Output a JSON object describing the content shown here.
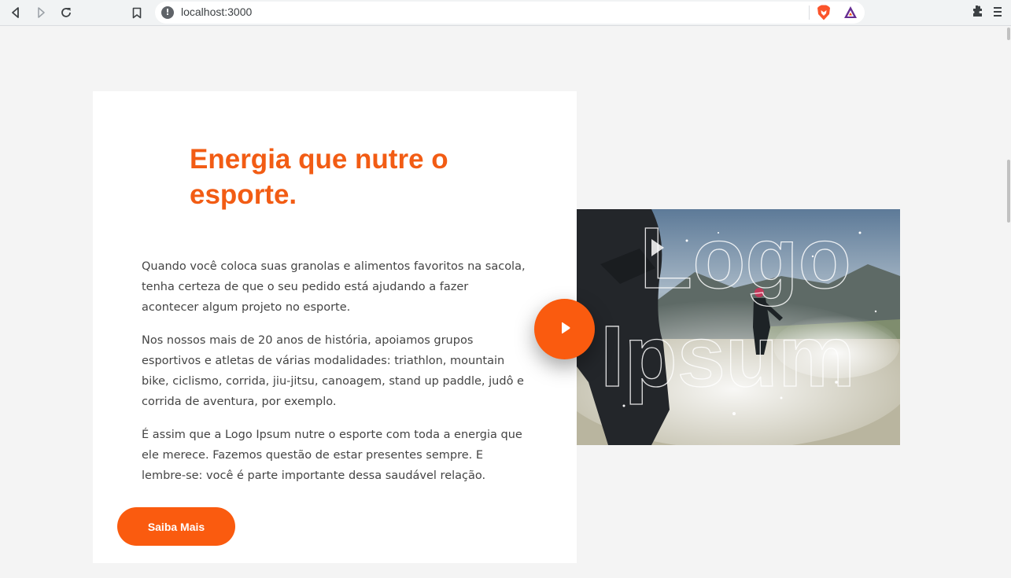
{
  "browser": {
    "url": "localhost:3000",
    "icons": [
      "back-icon",
      "forward-icon",
      "reload-icon",
      "bookmark-icon",
      "info-icon",
      "brave-shield-icon",
      "bat-rewards-icon",
      "extensions-icon",
      "menu-icon"
    ]
  },
  "hero": {
    "title": "Energia que nutre o esporte.",
    "paragraphs": [
      "Quando você coloca suas granolas e alimentos favoritos na sacola, tenha certeza de que o seu pedido está ajudando a fazer acontecer algum projeto no esporte.",
      "Nos nossos mais de 20 anos de história, apoiamos grupos esportivos e atletas de várias modalidades: triathlon, mountain bike, ciclismo, corrida, jiu-jitsu, canoagem, stand up paddle, judô e corrida de aventura, por exemplo.",
      "É assim que a Logo Ipsum nutre o esporte com toda a energia que ele merece. Fazemos questão de estar presentes sempre. E lembre-se: você é parte importante dessa saudável relação."
    ],
    "cta_label": "Saiba Mais",
    "image_logo_text": "Logo Ipsum"
  },
  "colors": {
    "accent": "#fa5b0f",
    "title": "#f25c14",
    "background": "#f4f4f4",
    "card": "#ffffff"
  }
}
